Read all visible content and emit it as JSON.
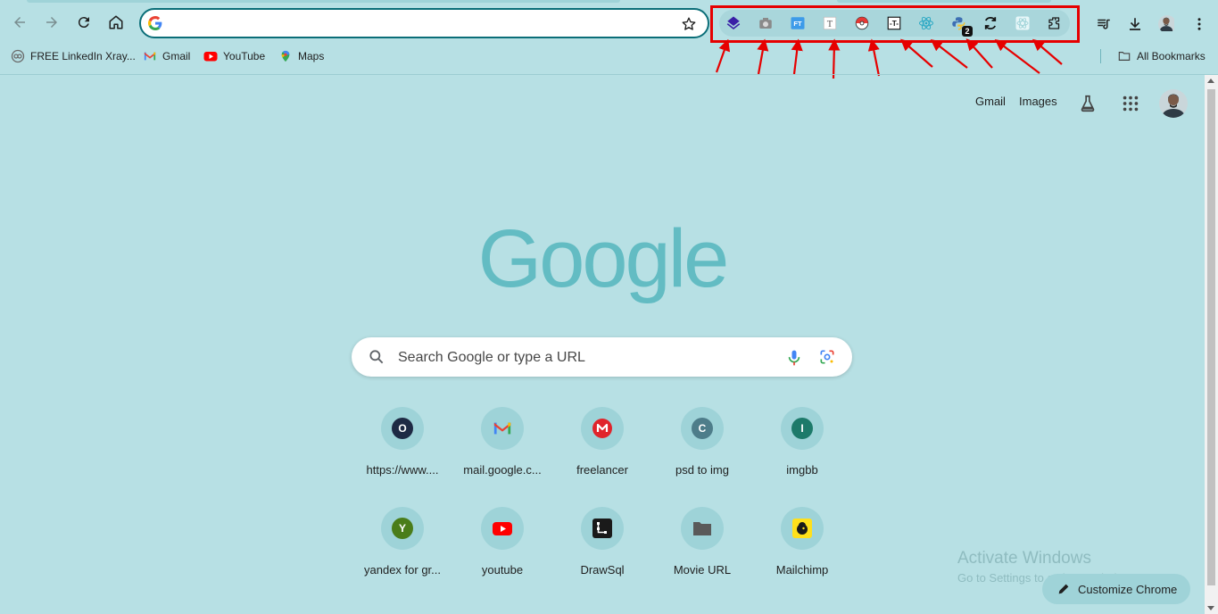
{
  "omnibox": {
    "value": "",
    "placeholder": ""
  },
  "extensions": [
    {
      "name": "layers-extension-icon",
      "color": "#3a1fa6"
    },
    {
      "name": "camera-extension-icon",
      "color": "#8a8a8a"
    },
    {
      "name": "ft-extension-icon",
      "color": "#3d9be9",
      "text": "FT"
    },
    {
      "name": "text-t-extension-icon",
      "color": "#555555",
      "text": "T"
    },
    {
      "name": "pokeball-extension-icon",
      "color": "#e53935"
    },
    {
      "name": "text-box-extension-icon",
      "color": "#111111",
      "text": "T"
    },
    {
      "name": "react-extension-icon",
      "color": "#2aa8c4"
    },
    {
      "name": "python-extension-icon",
      "color": "#3d6fb3",
      "badge": "2"
    },
    {
      "name": "refresh-extension-icon",
      "color": "#111111"
    },
    {
      "name": "react-light-extension-icon",
      "color": "#e6f6f8"
    },
    {
      "name": "puzzle-extensions-icon",
      "color": "#1f1f1f"
    }
  ],
  "bookmarks": [
    {
      "label": "FREE LinkedIn Xray...",
      "icon": "link-circle-icon"
    },
    {
      "label": "Gmail",
      "icon": "gmail-icon"
    },
    {
      "label": "YouTube",
      "icon": "youtube-icon"
    },
    {
      "label": "Maps",
      "icon": "maps-pin-icon"
    }
  ],
  "all_bookmarks": "All Bookmarks",
  "top_links": {
    "gmail": "Gmail",
    "images": "Images"
  },
  "logo_text": "Google",
  "search": {
    "placeholder": "Search Google or type a URL"
  },
  "shortcuts": [
    {
      "label": "https://www....",
      "letter": "O",
      "color": "#1e2a44"
    },
    {
      "label": "mail.google.c...",
      "letter": "",
      "color": "#ffffff",
      "icon": "gmail-icon"
    },
    {
      "label": "freelancer",
      "letter": "",
      "color": "#e0242b",
      "icon": "mega-icon"
    },
    {
      "label": "psd to img",
      "letter": "C",
      "color": "#4e7d8a"
    },
    {
      "label": "imgbb",
      "letter": "I",
      "color": "#1d7a6a"
    },
    {
      "label": "yandex for gr...",
      "letter": "Y",
      "color": "#4a7d1a"
    },
    {
      "label": "youtube",
      "letter": "",
      "color": "#ff0000",
      "icon": "youtube-icon"
    },
    {
      "label": "DrawSql",
      "letter": "",
      "color": "#1a1a1a",
      "icon": "drawsql-icon"
    },
    {
      "label": "Movie URL",
      "letter": "",
      "color": "#5a5a5a",
      "icon": "folder-icon"
    },
    {
      "label": "Mailchimp",
      "letter": "",
      "color": "#ffe01b",
      "icon": "mailchimp-icon"
    }
  ],
  "watermark": {
    "title": "Activate Windows",
    "subtitle": "Go to Settings to activate Windows."
  },
  "customize": "Customize Chrome",
  "accent": "#63bcc3",
  "background": "#b7e0e4"
}
